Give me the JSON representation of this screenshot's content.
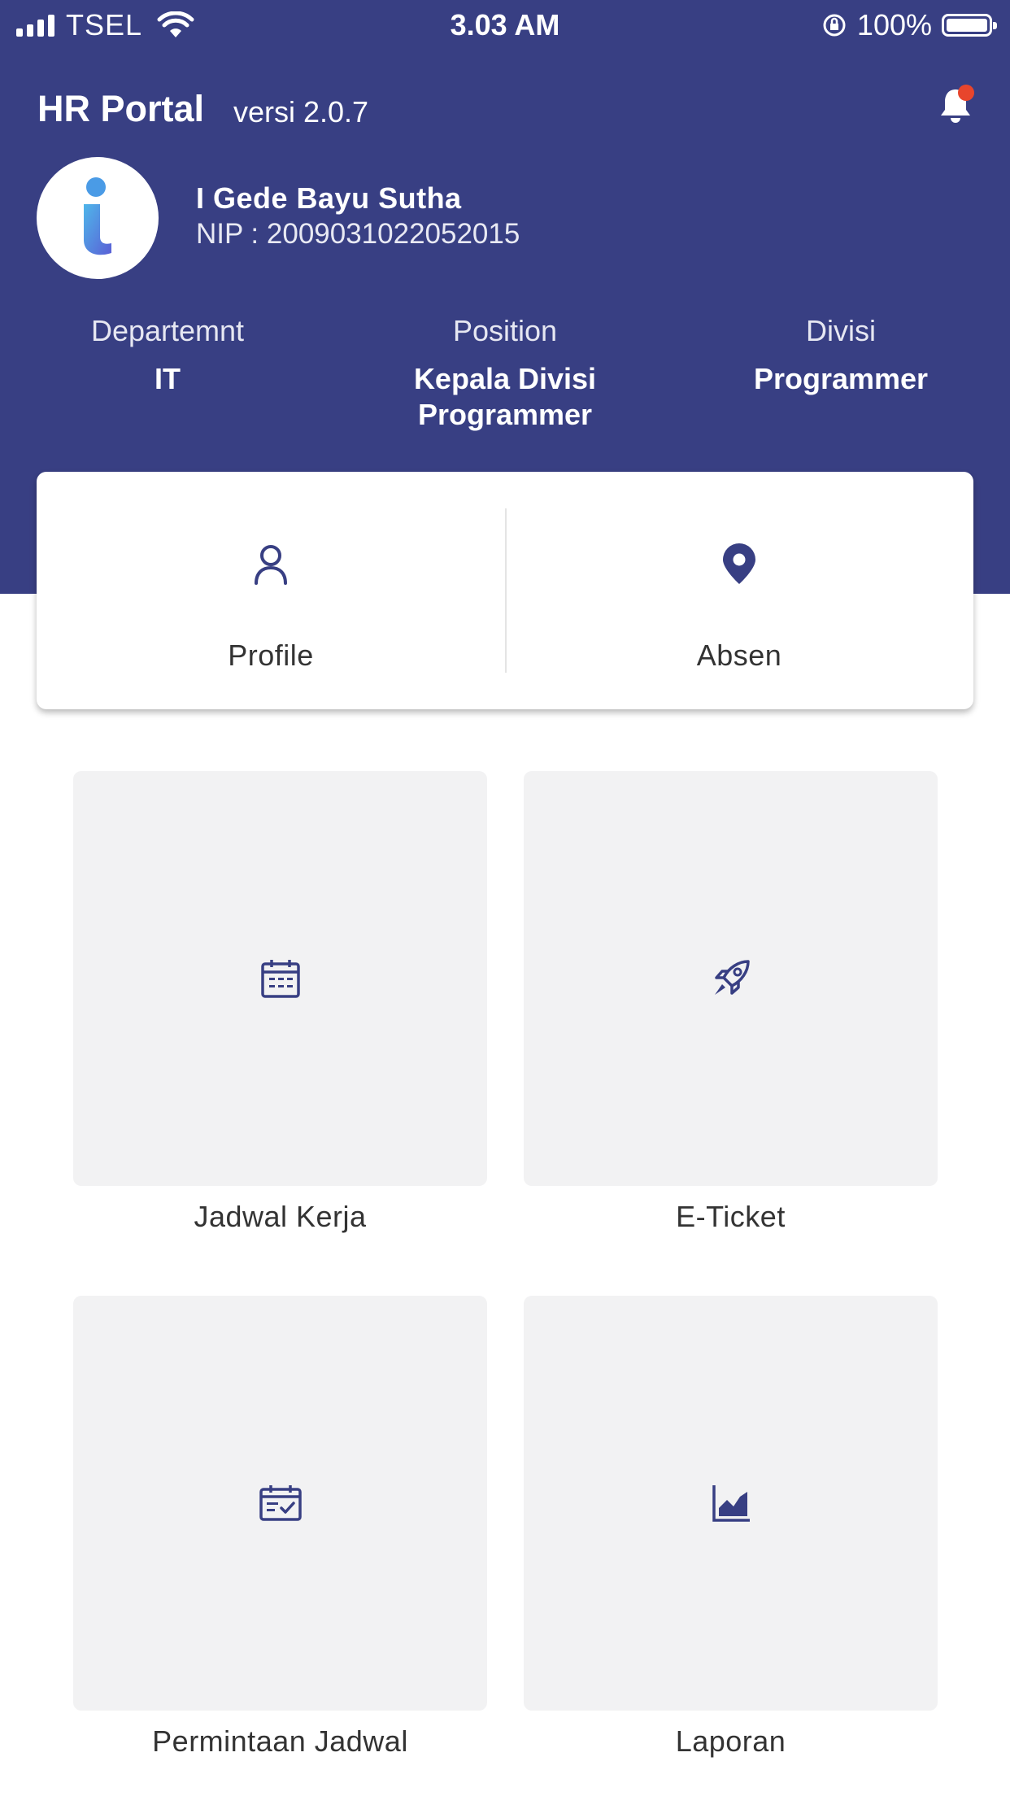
{
  "status_bar": {
    "carrier": "TSEL",
    "time": "3.03 AM",
    "battery": "100%"
  },
  "header": {
    "app_title": "HR Portal",
    "version": "versi 2.0.7",
    "notification_icon": "bell-icon",
    "has_unread": true
  },
  "user": {
    "avatar_icon": "app-logo-icon",
    "name": "I Gede Bayu Sutha",
    "nip": "NIP : 2009031022052015"
  },
  "info": [
    {
      "label": "Departemnt",
      "value": "IT"
    },
    {
      "label": "Position",
      "value": "Kepala Divisi Programmer"
    },
    {
      "label": "Divisi",
      "value": "Programmer"
    }
  ],
  "actions": [
    {
      "label": "Profile",
      "icon": "person-icon"
    },
    {
      "label": "Absen",
      "icon": "location-pin-icon"
    }
  ],
  "menu": [
    {
      "label": "Jadwal Kerja",
      "icon": "calendar-icon"
    },
    {
      "label": "E-Ticket",
      "icon": "rocket-icon"
    },
    {
      "label": "Permintaan Jadwal",
      "icon": "calendar-check-icon"
    },
    {
      "label": "Laporan",
      "icon": "area-chart-icon"
    }
  ],
  "colors": {
    "primary": "#383f83",
    "badge": "#e8452c",
    "tile_bg": "#f2f2f3"
  }
}
